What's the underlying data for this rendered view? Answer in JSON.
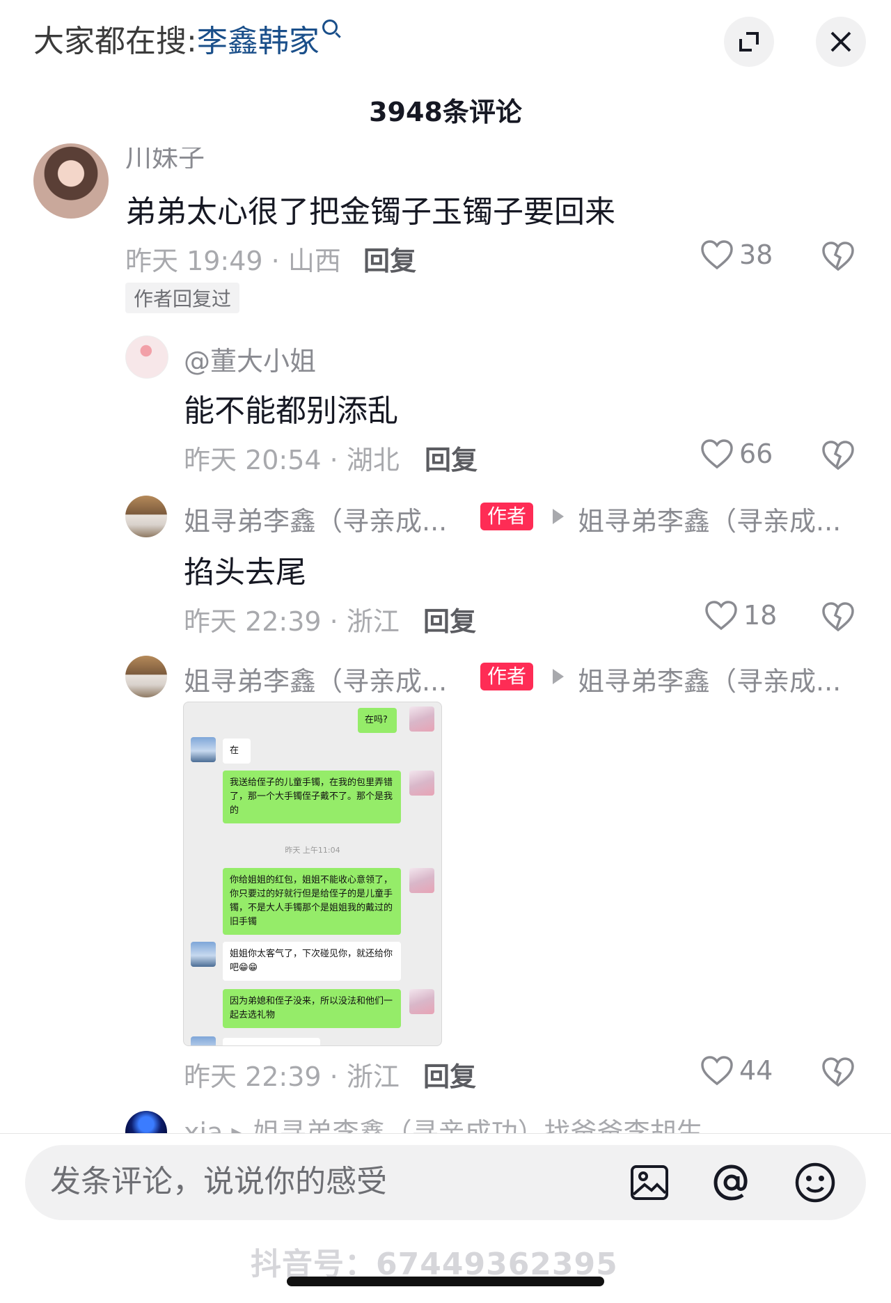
{
  "header": {
    "search_prefix": "大家都在搜:",
    "search_keyword": "李鑫韩家",
    "comment_count": "3948条评论"
  },
  "comments": [
    {
      "username": "川妹子",
      "text": "弟弟太心很了把金镯子玉镯子要回来",
      "time_loc": "昨天 19:49 · 山西",
      "reply_label": "回复",
      "likes": "38",
      "badge": "作者回复过"
    },
    {
      "username": "@董大小姐",
      "text": "能不能都别添乱",
      "time_loc": "昨天 20:54 · 湖北",
      "reply_label": "回复",
      "likes": "66"
    },
    {
      "username": "姐寻弟李鑫（寻亲成...",
      "author_tag": "作者",
      "reply_to": "姐寻弟李鑫（寻亲成...",
      "text": "掐头去尾",
      "time_loc": "昨天 22:39 · 浙江",
      "reply_label": "回复",
      "likes": "18"
    },
    {
      "username": "姐寻弟李鑫（寻亲成...",
      "author_tag": "作者",
      "reply_to": "姐寻弟李鑫（寻亲成...",
      "time_loc": "昨天 22:39 · 浙江",
      "reply_label": "回复",
      "likes": "44"
    }
  ],
  "chat_image": {
    "msg1": "在吗?",
    "msg2": "在",
    "msg3": "我送给侄子的儿童手镯，在我的包里弄错了，那一个大手镯侄子戴不了。那个是我的",
    "time": "昨天 上午11:04",
    "msg4": "你给姐姐的红包，姐姐不能收心意领了，你只要过的好就行但是给侄子的是儿童手镯，不是大人手镯那个是姐姐我的戴过的旧手镯",
    "msg5": "姐姐你太客气了，下次碰见你，就还给你吧😁😁",
    "msg6": "因为弟媳和侄子没来，所以没法和他们一起去选礼物"
  },
  "next_comment_preview": "xia ▸ 姐寻弟李鑫（寻亲成功）找爸爸李胡生",
  "input": {
    "placeholder": "发条评论，说说你的感受"
  },
  "watermark": "抖音号：67449362395",
  "icons": {
    "expand": "expand-icon",
    "close": "close-icon",
    "image": "image-icon",
    "mention": "at-icon",
    "emoji": "emoji-icon"
  }
}
